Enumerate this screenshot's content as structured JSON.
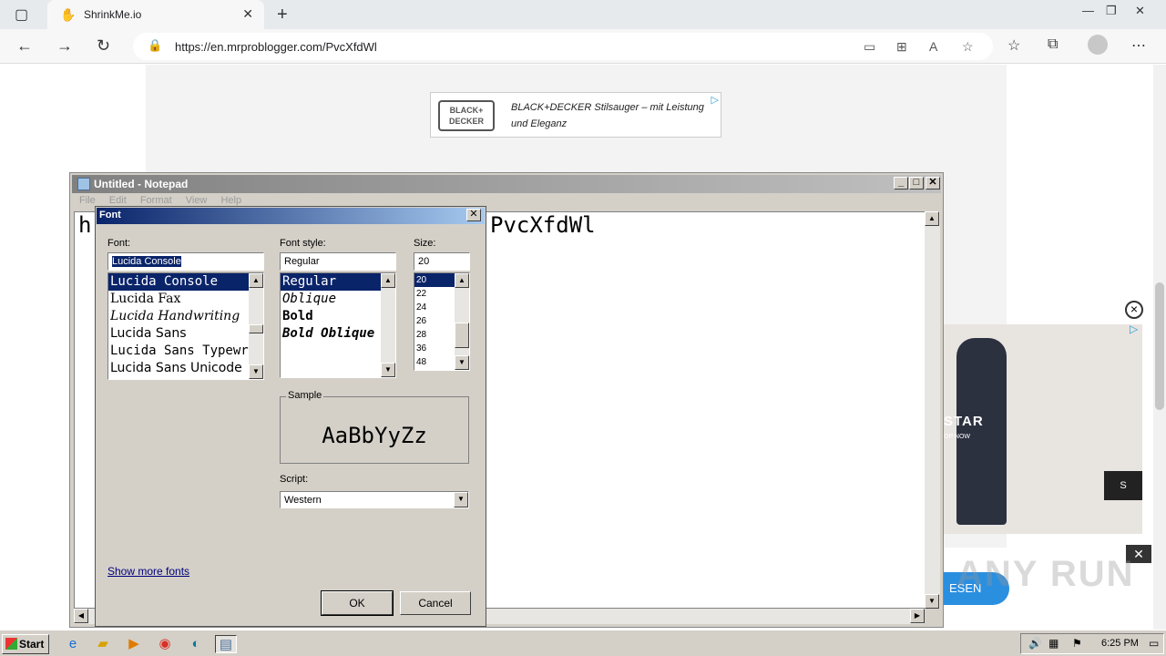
{
  "browser": {
    "tab_title": "ShrinkMe.io",
    "tab_close": "✕",
    "new_tab": "+",
    "url": "https://en.mrproblogger.com/PvcXfdWl",
    "window_controls": {
      "minimize": "—",
      "restore": "❐",
      "close": "✕"
    }
  },
  "ads": {
    "top_brand": "BLACK+ DECKER",
    "top_text": "BLACK+DECKER Stilsauger – mit Leistung und Eleganz",
    "side_brand": "STAR",
    "side_shop": "OP NOW",
    "side_button": "S",
    "bottom_button": "ESEN",
    "watermark": "ANY RUN"
  },
  "notepad": {
    "title": "Untitled - Notepad",
    "menu": [
      "File",
      "Edit",
      "Format",
      "View",
      "Help"
    ],
    "text_left": "h",
    "text_right": "PvcXfdWl"
  },
  "font_dialog": {
    "title": "Font",
    "font_label": "Font:",
    "font_value": "Lucida Console",
    "fonts": [
      "Lucida Console",
      "Lucida Fax",
      "Lucida Handwriting",
      "Lucida Sans",
      "Lucida Sans Typewriter",
      "Lucida Sans Unicode"
    ],
    "style_label": "Font style:",
    "style_value": "Regular",
    "styles": [
      "Regular",
      "Oblique",
      "Bold",
      "Bold Oblique"
    ],
    "size_label": "Size:",
    "size_value": "20",
    "sizes": [
      "20",
      "22",
      "24",
      "26",
      "28",
      "36",
      "48"
    ],
    "sample_label": "Sample",
    "sample_text": "AaBbYyZz",
    "script_label": "Script:",
    "script_value": "Western",
    "show_more": "Show more fonts",
    "ok": "OK",
    "cancel": "Cancel"
  },
  "taskbar": {
    "start": "Start",
    "clock": "6:25 PM"
  }
}
